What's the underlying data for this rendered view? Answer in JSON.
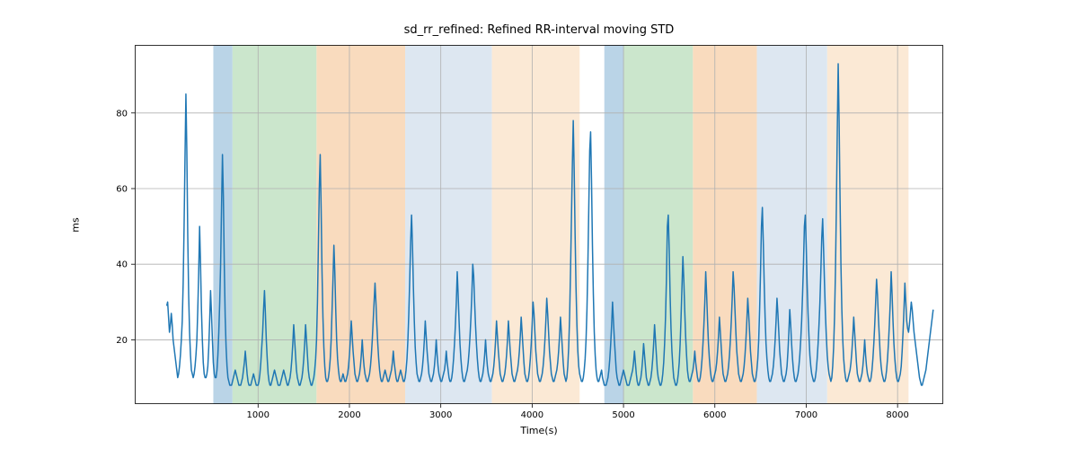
{
  "chart_data": {
    "type": "line",
    "title": "sd_rr_refined: Refined RR-interval moving STD",
    "xlabel": "Time(s)",
    "ylabel": "ms",
    "xlim": [
      -350,
      8500
    ],
    "ylim": [
      3,
      98
    ],
    "xticks": [
      1000,
      2000,
      3000,
      4000,
      5000,
      6000,
      7000,
      8000
    ],
    "yticks": [
      20,
      40,
      60,
      80
    ],
    "line_color": "#1f77b4",
    "shaded_regions": [
      {
        "x0": 510,
        "x1": 720,
        "color": "#bad4e7"
      },
      {
        "x0": 720,
        "x1": 1640,
        "color": "#cbe6cc"
      },
      {
        "x0": 1640,
        "x1": 2610,
        "color": "#f9dbbe"
      },
      {
        "x0": 2610,
        "x1": 3560,
        "color": "#dde7f1"
      },
      {
        "x0": 3560,
        "x1": 4520,
        "color": "#fbe9d5"
      },
      {
        "x0": 4790,
        "x1": 5000,
        "color": "#bad4e7"
      },
      {
        "x0": 5000,
        "x1": 5760,
        "color": "#cbe6cc"
      },
      {
        "x0": 5760,
        "x1": 6460,
        "color": "#f9dbbe"
      },
      {
        "x0": 6460,
        "x1": 7230,
        "color": "#dde7f1"
      },
      {
        "x0": 7230,
        "x1": 8120,
        "color": "#fbe9d5"
      }
    ],
    "series": [
      {
        "name": "sd_rr_refined",
        "x_start": 0,
        "x_step": 10,
        "values": [
          29,
          30,
          26,
          22,
          24,
          27,
          24,
          20,
          18,
          16,
          14,
          12,
          10,
          11,
          13,
          16,
          20,
          25,
          35,
          50,
          68,
          85,
          70,
          48,
          32,
          22,
          16,
          12,
          11,
          10,
          11,
          13,
          16,
          20,
          28,
          38,
          50,
          40,
          28,
          20,
          14,
          11,
          10,
          10,
          11,
          13,
          18,
          25,
          33,
          27,
          20,
          14,
          11,
          10,
          10,
          12,
          16,
          22,
          30,
          40,
          55,
          69,
          58,
          40,
          26,
          18,
          13,
          10,
          9,
          8,
          8,
          8,
          9,
          10,
          11,
          12,
          11,
          10,
          9,
          8,
          8,
          8,
          9,
          10,
          12,
          14,
          17,
          14,
          11,
          9,
          8,
          8,
          8,
          9,
          10,
          11,
          10,
          9,
          8,
          8,
          8,
          9,
          11,
          14,
          18,
          22,
          28,
          33,
          27,
          20,
          15,
          11,
          9,
          8,
          8,
          9,
          10,
          11,
          12,
          11,
          10,
          9,
          8,
          8,
          8,
          9,
          10,
          11,
          12,
          11,
          10,
          9,
          8,
          8,
          9,
          10,
          12,
          15,
          19,
          24,
          20,
          16,
          12,
          10,
          9,
          8,
          8,
          9,
          10,
          12,
          15,
          19,
          24,
          20,
          16,
          12,
          10,
          9,
          8,
          8,
          9,
          10,
          12,
          15,
          20,
          30,
          45,
          60,
          69,
          55,
          38,
          26,
          18,
          13,
          10,
          9,
          9,
          10,
          12,
          15,
          20,
          28,
          36,
          45,
          38,
          28,
          20,
          15,
          12,
          10,
          9,
          9,
          10,
          11,
          10,
          9,
          9,
          10,
          11,
          13,
          16,
          20,
          25,
          21,
          17,
          14,
          11,
          10,
          9,
          9,
          10,
          11,
          13,
          16,
          20,
          16,
          13,
          11,
          10,
          9,
          9,
          10,
          11,
          13,
          16,
          20,
          25,
          30,
          35,
          30,
          24,
          19,
          15,
          12,
          10,
          9,
          9,
          10,
          11,
          12,
          11,
          10,
          9,
          9,
          10,
          11,
          12,
          14,
          17,
          14,
          12,
          10,
          9,
          9,
          10,
          11,
          12,
          11,
          10,
          9,
          9,
          10,
          12,
          15,
          20,
          27,
          36,
          46,
          53,
          45,
          34,
          25,
          18,
          14,
          11,
          10,
          9,
          9,
          10,
          11,
          13,
          16,
          20,
          25,
          21,
          17,
          14,
          11,
          10,
          9,
          9,
          10,
          11,
          13,
          16,
          20,
          16,
          13,
          11,
          10,
          9,
          9,
          10,
          11,
          12,
          14,
          17,
          14,
          12,
          10,
          9,
          9,
          10,
          12,
          15,
          19,
          24,
          30,
          38,
          32,
          25,
          19,
          15,
          12,
          10,
          9,
          9,
          10,
          11,
          12,
          14,
          17,
          21,
          26,
          32,
          40,
          37,
          30,
          24,
          19,
          15,
          12,
          10,
          9,
          9,
          10,
          11,
          13,
          16,
          20,
          16,
          13,
          11,
          10,
          9,
          9,
          10,
          11,
          13,
          16,
          20,
          25,
          21,
          17,
          14,
          11,
          10,
          9,
          9,
          10,
          11,
          13,
          16,
          20,
          25,
          21,
          17,
          14,
          11,
          10,
          9,
          9,
          10,
          11,
          12,
          14,
          17,
          21,
          26,
          22,
          18,
          14,
          11,
          10,
          9,
          9,
          10,
          12,
          15,
          19,
          24,
          30,
          27,
          22,
          17,
          14,
          11,
          10,
          9,
          9,
          10,
          11,
          13,
          16,
          20,
          25,
          31,
          27,
          22,
          17,
          14,
          11,
          10,
          9,
          9,
          10,
          11,
          12,
          14,
          17,
          21,
          26,
          22,
          18,
          14,
          11,
          10,
          9,
          10,
          13,
          18,
          26,
          38,
          52,
          66,
          78,
          65,
          48,
          34,
          24,
          17,
          13,
          11,
          10,
          9,
          9,
          10,
          12,
          15,
          20,
          28,
          40,
          55,
          70,
          75,
          62,
          45,
          32,
          22,
          16,
          12,
          10,
          9,
          9,
          10,
          11,
          12,
          10,
          9,
          8,
          8,
          8,
          9,
          10,
          12,
          15,
          19,
          24,
          30,
          25,
          20,
          16,
          12,
          10,
          9,
          8,
          8,
          9,
          10,
          11,
          12,
          11,
          10,
          9,
          8,
          8,
          8,
          9,
          10,
          11,
          12,
          14,
          17,
          14,
          11,
          9,
          8,
          8,
          9,
          10,
          12,
          15,
          19,
          16,
          13,
          10,
          9,
          8,
          8,
          9,
          10,
          12,
          15,
          19,
          24,
          20,
          16,
          12,
          10,
          9,
          8,
          8,
          9,
          11,
          14,
          19,
          26,
          36,
          50,
          53,
          44,
          32,
          23,
          17,
          13,
          10,
          9,
          8,
          8,
          9,
          11,
          14,
          19,
          26,
          34,
          42,
          36,
          28,
          21,
          16,
          12,
          10,
          9,
          9,
          10,
          11,
          12,
          14,
          17,
          14,
          12,
          10,
          9,
          9,
          10,
          12,
          15,
          19,
          24,
          30,
          38,
          32,
          25,
          19,
          15,
          12,
          10,
          9,
          9,
          10,
          11,
          12,
          14,
          17,
          21,
          26,
          22,
          18,
          14,
          11,
          10,
          9,
          9,
          10,
          11,
          13,
          16,
          20,
          25,
          31,
          38,
          34,
          28,
          22,
          17,
          14,
          11,
          10,
          9,
          9,
          10,
          11,
          13,
          16,
          20,
          25,
          31,
          27,
          22,
          17,
          14,
          11,
          10,
          9,
          9,
          10,
          12,
          15,
          20,
          28,
          38,
          50,
          55,
          46,
          35,
          26,
          19,
          15,
          12,
          10,
          9,
          9,
          10,
          11,
          13,
          16,
          20,
          25,
          31,
          27,
          22,
          17,
          14,
          11,
          10,
          9,
          9,
          10,
          11,
          13,
          17,
          22,
          28,
          24,
          19,
          15,
          12,
          10,
          9,
          9,
          10,
          11,
          13,
          16,
          20,
          25,
          32,
          40,
          50,
          53,
          45,
          35,
          27,
          21,
          16,
          13,
          11,
          10,
          9,
          9,
          10,
          12,
          15,
          19,
          24,
          30,
          38,
          47,
          52,
          44,
          35,
          27,
          21,
          16,
          13,
          11,
          10,
          9,
          10,
          13,
          18,
          26,
          38,
          55,
          75,
          93,
          78,
          58,
          40,
          28,
          20,
          15,
          12,
          10,
          9,
          9,
          10,
          11,
          12,
          14,
          17,
          21,
          26,
          22,
          18,
          14,
          11,
          10,
          9,
          9,
          10,
          11,
          13,
          16,
          20,
          16,
          13,
          11,
          10,
          9,
          9,
          10,
          12,
          15,
          19,
          24,
          30,
          36,
          32,
          26,
          21,
          16,
          13,
          11,
          10,
          9,
          9,
          10,
          12,
          15,
          19,
          24,
          30,
          38,
          32,
          25,
          19,
          15,
          12,
          10,
          9,
          9,
          10,
          11,
          13,
          17,
          22,
          28,
          35,
          30,
          25,
          23,
          22,
          24,
          27,
          30,
          28,
          25,
          22,
          20,
          18,
          16,
          14,
          12,
          10,
          9,
          8,
          8,
          9,
          10,
          11,
          12,
          14,
          16,
          18,
          20,
          22,
          24,
          26,
          28
        ]
      }
    ]
  }
}
